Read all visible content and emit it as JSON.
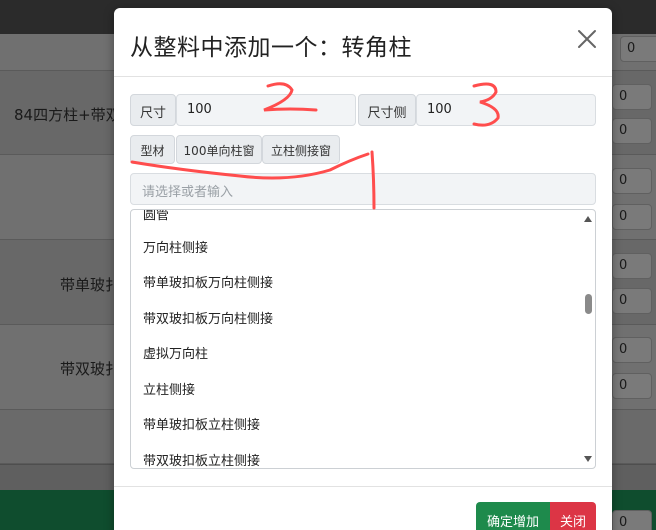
{
  "background": {
    "row_labels": [
      "84四方柱+带双",
      "带单玻扌",
      "带双玻扌"
    ],
    "row_values": [
      "0",
      "0",
      "0",
      "0",
      "0",
      "0",
      "0",
      "0",
      "0",
      "0"
    ]
  },
  "modal": {
    "title": "从整料中添加一个：转角柱",
    "close_icon": "close-icon",
    "size": {
      "label": "尺寸",
      "value": "100",
      "side_label": "尺寸侧",
      "side_value": "100"
    },
    "tags": [
      "型材",
      "100单向柱窗",
      "立柱侧接窗"
    ],
    "search": {
      "placeholder": "请选择或者输入"
    },
    "options": [
      "圆管",
      "万向柱侧接",
      "带单玻扣板万向柱侧接",
      "带双玻扣板万向柱侧接",
      "虚拟万向柱",
      "立柱侧接",
      "带单玻扣板立柱侧接",
      "带双玻扣板立柱侧接"
    ],
    "footer": {
      "confirm_label": "确定增加",
      "close_label": "关闭"
    }
  },
  "colors": {
    "confirm": "#1e8a4c",
    "close": "#dc3545",
    "annotation": "#ff4d4d"
  }
}
